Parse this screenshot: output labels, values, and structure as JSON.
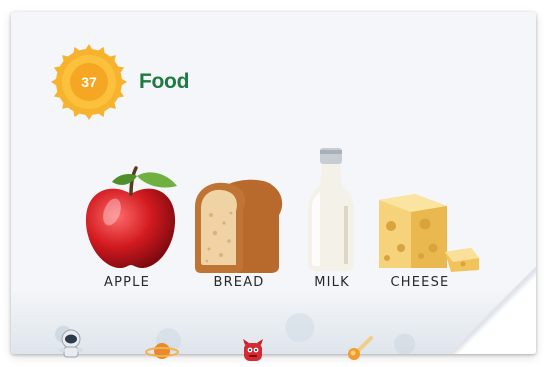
{
  "header": {
    "number": "37",
    "title": "Food"
  },
  "items": [
    {
      "label": "APPLE",
      "icon": "apple-image"
    },
    {
      "label": "BREAD",
      "icon": "bread-image"
    },
    {
      "label": "MILK",
      "icon": "milk-bottle-image"
    },
    {
      "label": "CHEESE",
      "icon": "cheese-image"
    }
  ],
  "decorations": [
    "astronaut-icon",
    "planet-icon",
    "monster-icon",
    "comet-icon"
  ],
  "colors": {
    "title": "#1e7a42",
    "sun": "#f5a623",
    "background": "#f4f6f9"
  }
}
